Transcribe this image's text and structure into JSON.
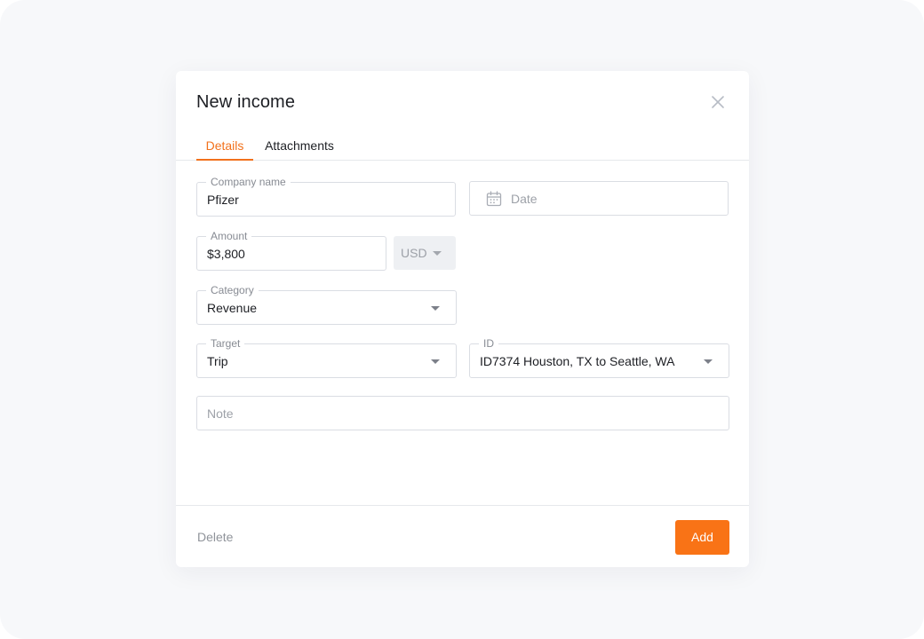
{
  "modal": {
    "title": "New income",
    "close_icon": "close-icon"
  },
  "tabs": [
    {
      "label": "Details",
      "active": true
    },
    {
      "label": "Attachments",
      "active": false
    }
  ],
  "form": {
    "company": {
      "label": "Company name",
      "value": "Pfizer"
    },
    "date": {
      "placeholder": "Date",
      "icon": "calendar-icon"
    },
    "amount": {
      "label": "Amount",
      "value": "$3,800"
    },
    "currency": {
      "value": "USD"
    },
    "category": {
      "label": "Category",
      "value": "Revenue"
    },
    "target": {
      "label": "Target",
      "value": "Trip"
    },
    "id": {
      "label": "ID",
      "value": "ID7374 Houston, TX to Seattle, WA"
    },
    "note": {
      "placeholder": "Note"
    }
  },
  "footer": {
    "delete_label": "Delete",
    "add_label": "Add"
  },
  "colors": {
    "accent": "#f97316",
    "active_tab": "#f2711c",
    "background": "#f7f8fa"
  }
}
